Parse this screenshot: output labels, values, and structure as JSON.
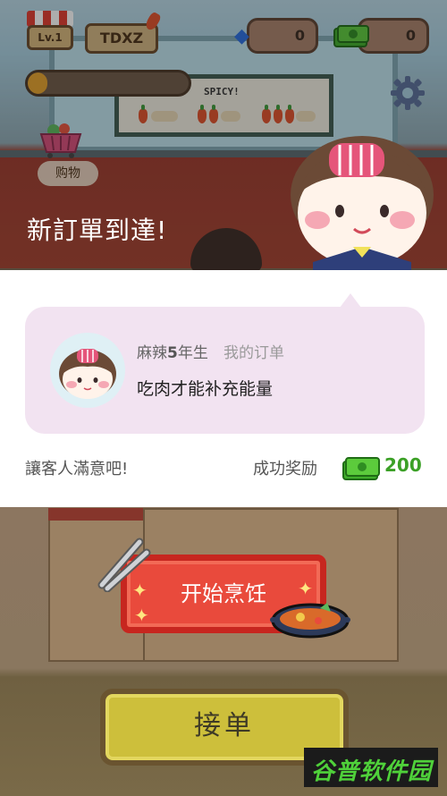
{
  "hud": {
    "level": "Lv.1",
    "player_name": "TDXZ",
    "gems": "0",
    "cash": "0",
    "xp_progress": 0.12,
    "shop_label": "购物"
  },
  "scene": {
    "sign_text": "SPICY!"
  },
  "order_dialog": {
    "title": "新訂單到達!",
    "customer_name_prefix": "麻辣",
    "customer_name_number": "5",
    "customer_name_suffix": "年生",
    "order_tag": "我的订单",
    "order_text": "吃肉才能补充能量",
    "satisfy_text": "讓客人滿意吧!",
    "reward_label": "成功奖励",
    "reward_amount": "200"
  },
  "buttons": {
    "start_cooking": "开始烹饪",
    "accept_order": "接单"
  },
  "watermark": {
    "text": "谷普软件园"
  },
  "colors": {
    "bubble_bg": "#f2e3f1",
    "reward_green": "#3ba026",
    "cook_red": "#e94a3c",
    "accept_yellow": "#cdbf3b"
  }
}
